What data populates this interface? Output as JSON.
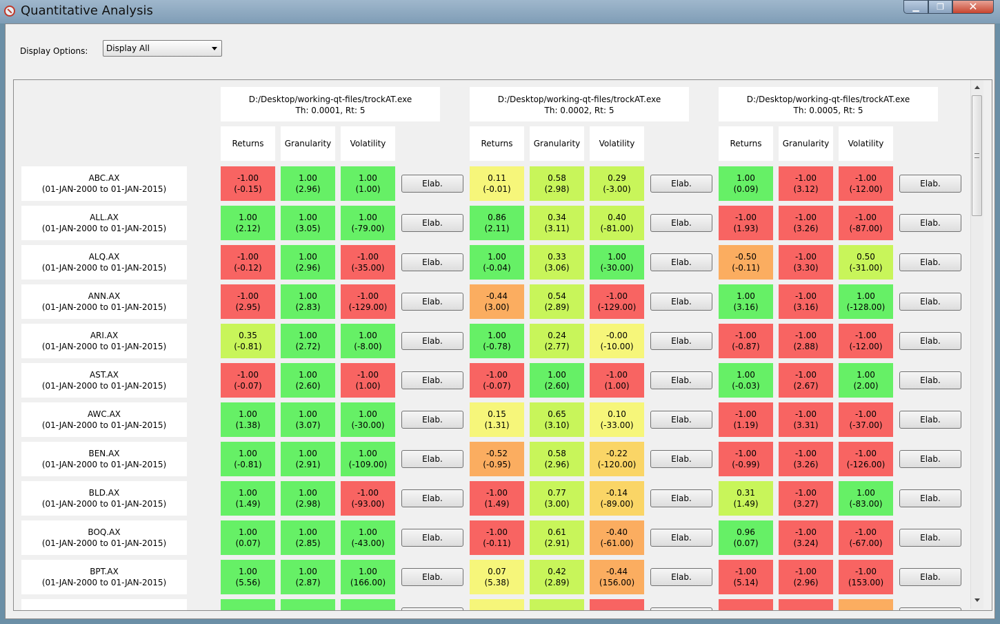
{
  "window": {
    "title": "Quantitative Analysis",
    "minimize_label": "▁",
    "maximize_label": "❐",
    "close_label": "✕"
  },
  "display_options": {
    "label": "Display Options:",
    "selected": "Display All"
  },
  "colors": {
    "green": "#66f066",
    "light_green": "#c8f55a",
    "yellow": "#f6f67a",
    "gold": "#fad566",
    "orange": "#fbad60",
    "red": "#f86462"
  },
  "groups": [
    {
      "path": "D:/Desktop/working-qt-files/trockAT.exe",
      "params": "Th: 0.0001, Rt: 5"
    },
    {
      "path": "D:/Desktop/working-qt-files/trockAT.exe",
      "params": "Th: 0.0002, Rt: 5"
    },
    {
      "path": "D:/Desktop/working-qt-files/trockAT.exe",
      "params": "Th: 0.0005, Rt: 5"
    }
  ],
  "column_headers": [
    "Returns",
    "Granularity",
    "Volatility"
  ],
  "elab_label": "Elab.",
  "rows": [
    {
      "ticker": "ABC.AX",
      "range": "(01-JAN-2000 to 01-JAN-2015)",
      "cells": [
        {
          "v": "-1.00",
          "s": "(-0.15)",
          "c": "red"
        },
        {
          "v": "1.00",
          "s": "(2.96)",
          "c": "green"
        },
        {
          "v": "1.00",
          "s": "(1.00)",
          "c": "green"
        },
        {
          "v": "0.11",
          "s": "(-0.01)",
          "c": "yellow"
        },
        {
          "v": "0.58",
          "s": "(2.98)",
          "c": "light_green"
        },
        {
          "v": "0.29",
          "s": "(-3.00)",
          "c": "light_green"
        },
        {
          "v": "1.00",
          "s": "(0.09)",
          "c": "green"
        },
        {
          "v": "-1.00",
          "s": "(3.12)",
          "c": "red"
        },
        {
          "v": "-1.00",
          "s": "(-12.00)",
          "c": "red"
        }
      ]
    },
    {
      "ticker": "ALL.AX",
      "range": "(01-JAN-2000 to 01-JAN-2015)",
      "cells": [
        {
          "v": "1.00",
          "s": "(2.12)",
          "c": "green"
        },
        {
          "v": "1.00",
          "s": "(3.05)",
          "c": "green"
        },
        {
          "v": "1.00",
          "s": "(-79.00)",
          "c": "green"
        },
        {
          "v": "0.86",
          "s": "(2.11)",
          "c": "green"
        },
        {
          "v": "0.34",
          "s": "(3.11)",
          "c": "light_green"
        },
        {
          "v": "0.40",
          "s": "(-81.00)",
          "c": "light_green"
        },
        {
          "v": "-1.00",
          "s": "(1.93)",
          "c": "red"
        },
        {
          "v": "-1.00",
          "s": "(3.26)",
          "c": "red"
        },
        {
          "v": "-1.00",
          "s": "(-87.00)",
          "c": "red"
        }
      ]
    },
    {
      "ticker": "ALQ.AX",
      "range": "(01-JAN-2000 to 01-JAN-2015)",
      "cells": [
        {
          "v": "-1.00",
          "s": "(-0.12)",
          "c": "red"
        },
        {
          "v": "1.00",
          "s": "(2.96)",
          "c": "green"
        },
        {
          "v": "-1.00",
          "s": "(-35.00)",
          "c": "red"
        },
        {
          "v": "1.00",
          "s": "(-0.04)",
          "c": "green"
        },
        {
          "v": "0.33",
          "s": "(3.06)",
          "c": "light_green"
        },
        {
          "v": "1.00",
          "s": "(-30.00)",
          "c": "green"
        },
        {
          "v": "-0.50",
          "s": "(-0.11)",
          "c": "orange"
        },
        {
          "v": "-1.00",
          "s": "(3.30)",
          "c": "red"
        },
        {
          "v": "0.50",
          "s": "(-31.00)",
          "c": "light_green"
        }
      ]
    },
    {
      "ticker": "ANN.AX",
      "range": "(01-JAN-2000 to 01-JAN-2015)",
      "cells": [
        {
          "v": "-1.00",
          "s": "(2.95)",
          "c": "red"
        },
        {
          "v": "1.00",
          "s": "(2.83)",
          "c": "green"
        },
        {
          "v": "-1.00",
          "s": "(-129.00)",
          "c": "red"
        },
        {
          "v": "-0.44",
          "s": "(3.00)",
          "c": "orange"
        },
        {
          "v": "0.54",
          "s": "(2.89)",
          "c": "light_green"
        },
        {
          "v": "-1.00",
          "s": "(-129.00)",
          "c": "red"
        },
        {
          "v": "1.00",
          "s": "(3.16)",
          "c": "green"
        },
        {
          "v": "-1.00",
          "s": "(3.16)",
          "c": "red"
        },
        {
          "v": "1.00",
          "s": "(-128.00)",
          "c": "green"
        }
      ]
    },
    {
      "ticker": "ARI.AX",
      "range": "(01-JAN-2000 to 01-JAN-2015)",
      "cells": [
        {
          "v": "0.35",
          "s": "(-0.81)",
          "c": "light_green"
        },
        {
          "v": "1.00",
          "s": "(2.72)",
          "c": "green"
        },
        {
          "v": "1.00",
          "s": "(-8.00)",
          "c": "green"
        },
        {
          "v": "1.00",
          "s": "(-0.78)",
          "c": "green"
        },
        {
          "v": "0.24",
          "s": "(2.77)",
          "c": "light_green"
        },
        {
          "v": "-0.00",
          "s": "(-10.00)",
          "c": "yellow"
        },
        {
          "v": "-1.00",
          "s": "(-0.87)",
          "c": "red"
        },
        {
          "v": "-1.00",
          "s": "(2.88)",
          "c": "red"
        },
        {
          "v": "-1.00",
          "s": "(-12.00)",
          "c": "red"
        }
      ]
    },
    {
      "ticker": "AST.AX",
      "range": "(01-JAN-2000 to 01-JAN-2015)",
      "cells": [
        {
          "v": "-1.00",
          "s": "(-0.07)",
          "c": "red"
        },
        {
          "v": "1.00",
          "s": "(2.60)",
          "c": "green"
        },
        {
          "v": "-1.00",
          "s": "(1.00)",
          "c": "red"
        },
        {
          "v": "-1.00",
          "s": "(-0.07)",
          "c": "red"
        },
        {
          "v": "1.00",
          "s": "(2.60)",
          "c": "green"
        },
        {
          "v": "-1.00",
          "s": "(1.00)",
          "c": "red"
        },
        {
          "v": "1.00",
          "s": "(-0.03)",
          "c": "green"
        },
        {
          "v": "-1.00",
          "s": "(2.67)",
          "c": "red"
        },
        {
          "v": "1.00",
          "s": "(2.00)",
          "c": "green"
        }
      ]
    },
    {
      "ticker": "AWC.AX",
      "range": "(01-JAN-2000 to 01-JAN-2015)",
      "cells": [
        {
          "v": "1.00",
          "s": "(1.38)",
          "c": "green"
        },
        {
          "v": "1.00",
          "s": "(3.07)",
          "c": "green"
        },
        {
          "v": "1.00",
          "s": "(-30.00)",
          "c": "green"
        },
        {
          "v": "0.15",
          "s": "(1.31)",
          "c": "yellow"
        },
        {
          "v": "0.65",
          "s": "(3.10)",
          "c": "light_green"
        },
        {
          "v": "0.10",
          "s": "(-33.00)",
          "c": "yellow"
        },
        {
          "v": "-1.00",
          "s": "(1.19)",
          "c": "red"
        },
        {
          "v": "-1.00",
          "s": "(3.31)",
          "c": "red"
        },
        {
          "v": "-1.00",
          "s": "(-37.00)",
          "c": "red"
        }
      ]
    },
    {
      "ticker": "BEN.AX",
      "range": "(01-JAN-2000 to 01-JAN-2015)",
      "cells": [
        {
          "v": "1.00",
          "s": "(-0.81)",
          "c": "green"
        },
        {
          "v": "1.00",
          "s": "(2.91)",
          "c": "green"
        },
        {
          "v": "1.00",
          "s": "(-109.00)",
          "c": "green"
        },
        {
          "v": "-0.52",
          "s": "(-0.95)",
          "c": "orange"
        },
        {
          "v": "0.58",
          "s": "(2.96)",
          "c": "light_green"
        },
        {
          "v": "-0.22",
          "s": "(-120.00)",
          "c": "gold"
        },
        {
          "v": "-1.00",
          "s": "(-0.99)",
          "c": "red"
        },
        {
          "v": "-1.00",
          "s": "(3.26)",
          "c": "red"
        },
        {
          "v": "-1.00",
          "s": "(-126.00)",
          "c": "red"
        }
      ]
    },
    {
      "ticker": "BLD.AX",
      "range": "(01-JAN-2000 to 01-JAN-2015)",
      "cells": [
        {
          "v": "1.00",
          "s": "(1.49)",
          "c": "green"
        },
        {
          "v": "1.00",
          "s": "(2.98)",
          "c": "green"
        },
        {
          "v": "-1.00",
          "s": "(-93.00)",
          "c": "red"
        },
        {
          "v": "-1.00",
          "s": "(1.49)",
          "c": "red"
        },
        {
          "v": "0.77",
          "s": "(3.00)",
          "c": "light_green"
        },
        {
          "v": "-0.14",
          "s": "(-89.00)",
          "c": "gold"
        },
        {
          "v": "0.31",
          "s": "(1.49)",
          "c": "light_green"
        },
        {
          "v": "-1.00",
          "s": "(3.27)",
          "c": "red"
        },
        {
          "v": "1.00",
          "s": "(-83.00)",
          "c": "green"
        }
      ]
    },
    {
      "ticker": "BOQ.AX",
      "range": "(01-JAN-2000 to 01-JAN-2015)",
      "cells": [
        {
          "v": "1.00",
          "s": "(0.07)",
          "c": "green"
        },
        {
          "v": "1.00",
          "s": "(2.85)",
          "c": "green"
        },
        {
          "v": "1.00",
          "s": "(-43.00)",
          "c": "green"
        },
        {
          "v": "-1.00",
          "s": "(-0.11)",
          "c": "red"
        },
        {
          "v": "0.61",
          "s": "(2.91)",
          "c": "light_green"
        },
        {
          "v": "-0.40",
          "s": "(-61.00)",
          "c": "orange"
        },
        {
          "v": "0.96",
          "s": "(0.07)",
          "c": "green"
        },
        {
          "v": "-1.00",
          "s": "(3.24)",
          "c": "red"
        },
        {
          "v": "-1.00",
          "s": "(-67.00)",
          "c": "red"
        }
      ]
    },
    {
      "ticker": "BPT.AX",
      "range": "(01-JAN-2000 to 01-JAN-2015)",
      "cells": [
        {
          "v": "1.00",
          "s": "(5.56)",
          "c": "green"
        },
        {
          "v": "1.00",
          "s": "(2.87)",
          "c": "green"
        },
        {
          "v": "1.00",
          "s": "(166.00)",
          "c": "green"
        },
        {
          "v": "0.07",
          "s": "(5.38)",
          "c": "yellow"
        },
        {
          "v": "0.42",
          "s": "(2.89)",
          "c": "light_green"
        },
        {
          "v": "-0.44",
          "s": "(156.00)",
          "c": "orange"
        },
        {
          "v": "-1.00",
          "s": "(5.14)",
          "c": "red"
        },
        {
          "v": "-1.00",
          "s": "(2.96)",
          "c": "red"
        },
        {
          "v": "-1.00",
          "s": "(153.00)",
          "c": "red"
        }
      ]
    }
  ],
  "partial_row_colors": [
    "green",
    "green",
    "green",
    "yellow",
    "light_green",
    "red",
    "red",
    "red",
    "orange"
  ]
}
